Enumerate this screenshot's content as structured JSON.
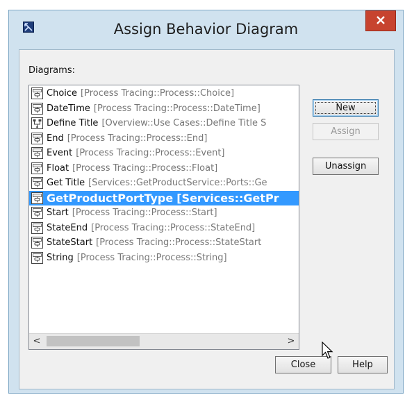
{
  "window": {
    "title": "Assign Behavior Diagram",
    "close_glyph": "✕"
  },
  "diagrams_label": "Diagrams:",
  "list": {
    "items": [
      {
        "name": "Choice",
        "path": "[Process Tracing::Process::Choice]",
        "icon": "state-machine-diagram-icon",
        "selected": false
      },
      {
        "name": "DateTime",
        "path": "[Process Tracing::Process::DateTime]",
        "icon": "state-machine-diagram-icon",
        "selected": false
      },
      {
        "name": "Define Title",
        "path": "[Overview::Use Cases::Define Title S",
        "icon": "activity-diagram-icon",
        "selected": false
      },
      {
        "name": "End",
        "path": "[Process Tracing::Process::End]",
        "icon": "state-machine-diagram-icon",
        "selected": false
      },
      {
        "name": "Event",
        "path": "[Process Tracing::Process::Event]",
        "icon": "state-machine-diagram-icon",
        "selected": false
      },
      {
        "name": "Float",
        "path": "[Process Tracing::Process::Float]",
        "icon": "state-machine-diagram-icon",
        "selected": false
      },
      {
        "name": "Get Title",
        "path": "[Services::GetProductService::Ports::Ge",
        "icon": "state-machine-diagram-icon",
        "selected": false
      },
      {
        "name": "GetProductPortType",
        "path": "[Services::GetPr",
        "icon": "state-machine-diagram-icon",
        "selected": true
      },
      {
        "name": "Start",
        "path": "[Process Tracing::Process::Start]",
        "icon": "state-machine-diagram-icon",
        "selected": false
      },
      {
        "name": "StateEnd",
        "path": "[Process Tracing::Process::StateEnd]",
        "icon": "state-machine-diagram-icon",
        "selected": false
      },
      {
        "name": "StateStart",
        "path": "[Process Tracing::Process::StateStart",
        "icon": "state-machine-diagram-icon",
        "selected": false
      },
      {
        "name": "String",
        "path": "[Process Tracing::Process::String]",
        "icon": "state-machine-diagram-icon",
        "selected": false
      }
    ],
    "scroll_left_glyph": "<",
    "scroll_right_glyph": ">"
  },
  "buttons": {
    "new": "New",
    "assign": "Assign",
    "unassign": "Unassign",
    "close": "Close",
    "help": "Help"
  },
  "colors": {
    "selection": "#3399ff",
    "title_close": "#c7432f",
    "frame": "#d0e2ef"
  }
}
